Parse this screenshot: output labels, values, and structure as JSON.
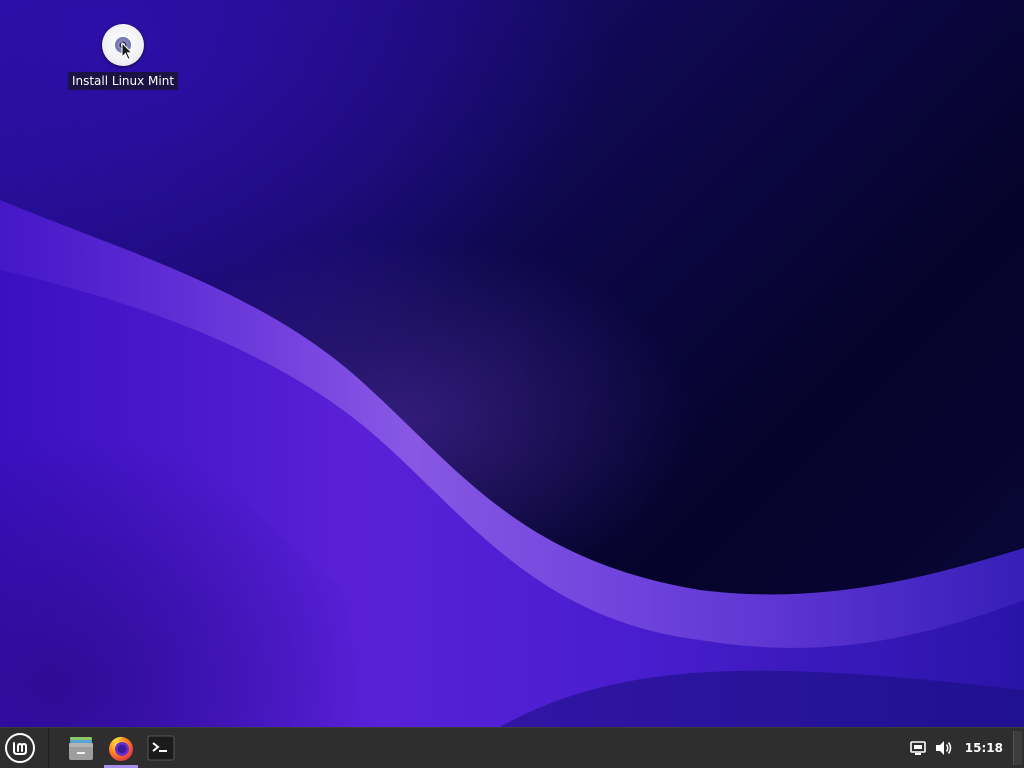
{
  "desktop": {
    "icons": [
      {
        "label": "Install Linux Mint",
        "icon": "disc-icon"
      }
    ],
    "wallpaper_colors": {
      "base": "#0f0850",
      "wave": "#6a3ee0",
      "glow": "#b48cf0"
    }
  },
  "panel": {
    "menu_icon": "linux-mint-logo-icon",
    "launchers": [
      {
        "icon": "file-manager-icon",
        "active": false
      },
      {
        "icon": "firefox-icon",
        "active": true
      },
      {
        "icon": "terminal-icon",
        "active": false
      }
    ],
    "tray": {
      "network_icon": "network-icon",
      "volume_icon": "volume-icon",
      "clock": "15:18"
    },
    "accent_color": "#a58ee8"
  }
}
